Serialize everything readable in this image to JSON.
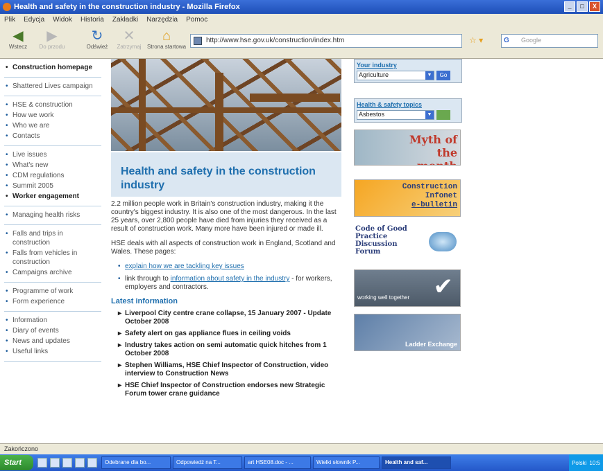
{
  "window": {
    "title": "Health and safety in the construction industry - Mozilla Firefox",
    "buttons": [
      "_",
      "□",
      "X"
    ]
  },
  "menu": [
    "Plik",
    "Edycja",
    "Widok",
    "Historia",
    "Zakładki",
    "Narzędzia",
    "Pomoc"
  ],
  "toolbar": {
    "back_label": "Wstecz",
    "forward_label": "Do przodu",
    "reload_label": "Odśwież",
    "stop_label": "Zatrzymaj",
    "home_label": "Strona startowa",
    "url": "http://www.hse.gov.uk/construction/index.htm",
    "search_placeholder": "Google"
  },
  "leftnav": {
    "groups": [
      [
        {
          "label": "Construction homepage",
          "strong": true
        }
      ],
      [
        {
          "label": "Shattered Lives campaign"
        }
      ],
      [
        {
          "label": "HSE & construction"
        },
        {
          "label": "How we work"
        },
        {
          "label": "Who we are"
        },
        {
          "label": "Contacts"
        }
      ],
      [
        {
          "label": "Live issues"
        },
        {
          "label": "What's new"
        },
        {
          "label": "CDM regulations"
        },
        {
          "label": "Summit 2005"
        },
        {
          "label": "Worker engagement",
          "strong": true
        }
      ],
      [
        {
          "label": "Managing health risks"
        }
      ],
      [
        {
          "label": "Falls and trips in construction"
        },
        {
          "label": "Falls from vehicles in construction"
        },
        {
          "label": "Campaigns archive"
        }
      ],
      [
        {
          "label": "Programme of work"
        },
        {
          "label": "Form experience"
        }
      ],
      [
        {
          "label": "Information"
        },
        {
          "label": "Diary of events"
        },
        {
          "label": "News and updates"
        },
        {
          "label": "Useful links"
        }
      ]
    ]
  },
  "main": {
    "headline": "Health and safety in the construction industry",
    "para1": "2.2 million people work in Britain's construction industry, making it the country's biggest industry. It is also one of the most dangerous. In the last 25 years, over 2,800 people have died from injuries they received as a result of construction work. Many more have been injured or made ill.",
    "para2": "HSE deals with all aspects of construction work in England, Scotland and Wales. These pages:",
    "bullet1": "explain how we are tackling key issues",
    "bullet2_pre": "link through to ",
    "bullet2_link": "information about safety in the industry",
    "bullet2_post": " - for workers, employers and contractors.",
    "latest_heading": "Latest information",
    "news": [
      "Liverpool City centre crane collapse, 15 January 2007 - Update October 2008",
      "Safety alert on gas appliance flues in ceiling voids",
      "Industry takes action on semi automatic quick hitches from 1 October 2008",
      "Stephen Williams, HSE Chief Inspector of Construction, video interview to Construction News",
      "HSE Chief Inspector of Construction endorses new Strategic Forum tower crane guidance"
    ]
  },
  "rightcol": {
    "industry_label": "Your industry",
    "industry_value": "Agriculture",
    "topics_label": "Health & safety topics",
    "topics_value": "Asbestos",
    "go_label": "Go",
    "myth_text": "Myth of the month",
    "infonet_line1": "Construction",
    "infonet_line2": "Infonet",
    "infonet_line3": "e-bulletin",
    "code_text": "Code of Good Practice Discussion Forum",
    "working_text": "working well together",
    "ladder_text": "Ladder Exchange"
  },
  "status": {
    "text": "Zakończono"
  },
  "taskbar": {
    "start": "Start",
    "tasks": [
      "Odebrane dla bo...",
      "Odpowiedź na T...",
      "art HSE08.doc - ...",
      "Wielki słownik P...",
      "Health and saf..."
    ],
    "tray_text": "Polski",
    "clock": "10:5"
  }
}
